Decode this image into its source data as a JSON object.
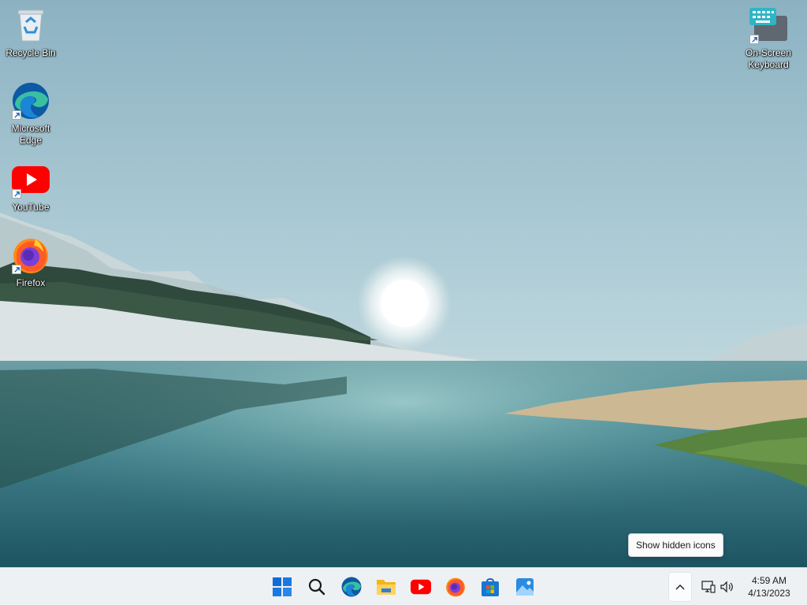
{
  "desktop": {
    "icons": [
      {
        "label": "Recycle Bin",
        "icon": "recycle-bin-icon"
      },
      {
        "label": "Microsoft Edge",
        "icon": "edge-icon"
      },
      {
        "label": "YouTube",
        "icon": "youtube-icon"
      },
      {
        "label": "Firefox",
        "icon": "firefox-icon"
      },
      {
        "label": "On-Screen Keyboard",
        "icon": "keyboard-icon"
      }
    ]
  },
  "taskbar": {
    "apps": [
      {
        "name": "Start",
        "icon": "windows-start-icon"
      },
      {
        "name": "Search",
        "icon": "search-icon"
      },
      {
        "name": "Microsoft Edge",
        "icon": "edge-icon"
      },
      {
        "name": "File Explorer",
        "icon": "folder-icon"
      },
      {
        "name": "YouTube",
        "icon": "youtube-icon"
      },
      {
        "name": "Firefox",
        "icon": "firefox-icon"
      },
      {
        "name": "Microsoft Store",
        "icon": "store-icon"
      },
      {
        "name": "Photos",
        "icon": "photos-icon"
      }
    ],
    "tray": {
      "time": "4:59 AM",
      "date": "4/13/2023",
      "icons": [
        "chevron-up-icon",
        "network-icon",
        "volume-icon"
      ]
    }
  },
  "tooltip": {
    "text": "Show hidden icons"
  },
  "colors": {
    "taskbar_bg": "#eef1f4",
    "start_blue": "#0f6cd8",
    "youtube_red": "#ff0000"
  }
}
